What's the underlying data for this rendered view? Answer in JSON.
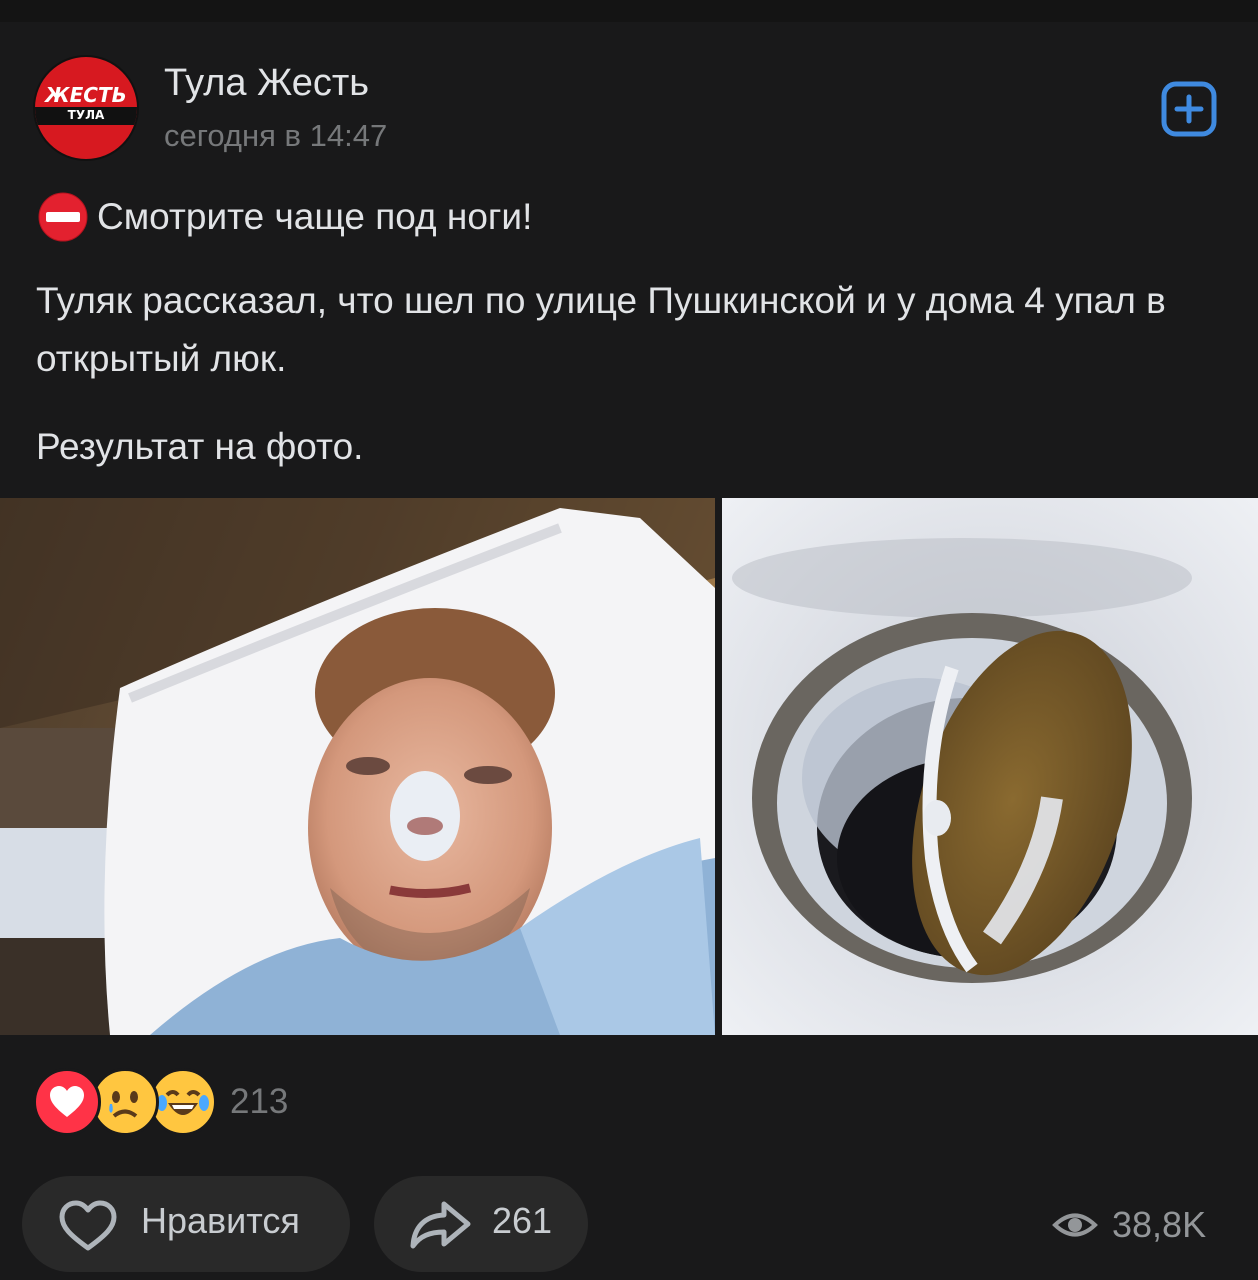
{
  "post": {
    "group_name": "Тула Жесть",
    "time": "сегодня в 14:47",
    "avatar_text_top": "ЖЕСТЬ",
    "avatar_text_bottom": "ТУЛА",
    "headline_emoji": "no-entry-icon",
    "headline": "Смотрите чаще под ноги!",
    "paragraph_1": "Туляк рассказал, что шел по улице Пушкинской и у дома 4 упал в открытый люк.",
    "paragraph_2": "Результат на фото.",
    "photos": [
      "hospital-selfie-photo",
      "open-manhole-photo"
    ]
  },
  "reactions": {
    "icons": [
      "heart-icon",
      "crying-face-icon",
      "laughing-face-icon"
    ],
    "count": "213"
  },
  "actions": {
    "like_label": "Нравится",
    "share_count": "261",
    "views": "38,8K"
  },
  "colors": {
    "background": "#19191a",
    "accent": "#3f8ae0",
    "button_bg": "#292929",
    "brand_red": "#d71920"
  }
}
